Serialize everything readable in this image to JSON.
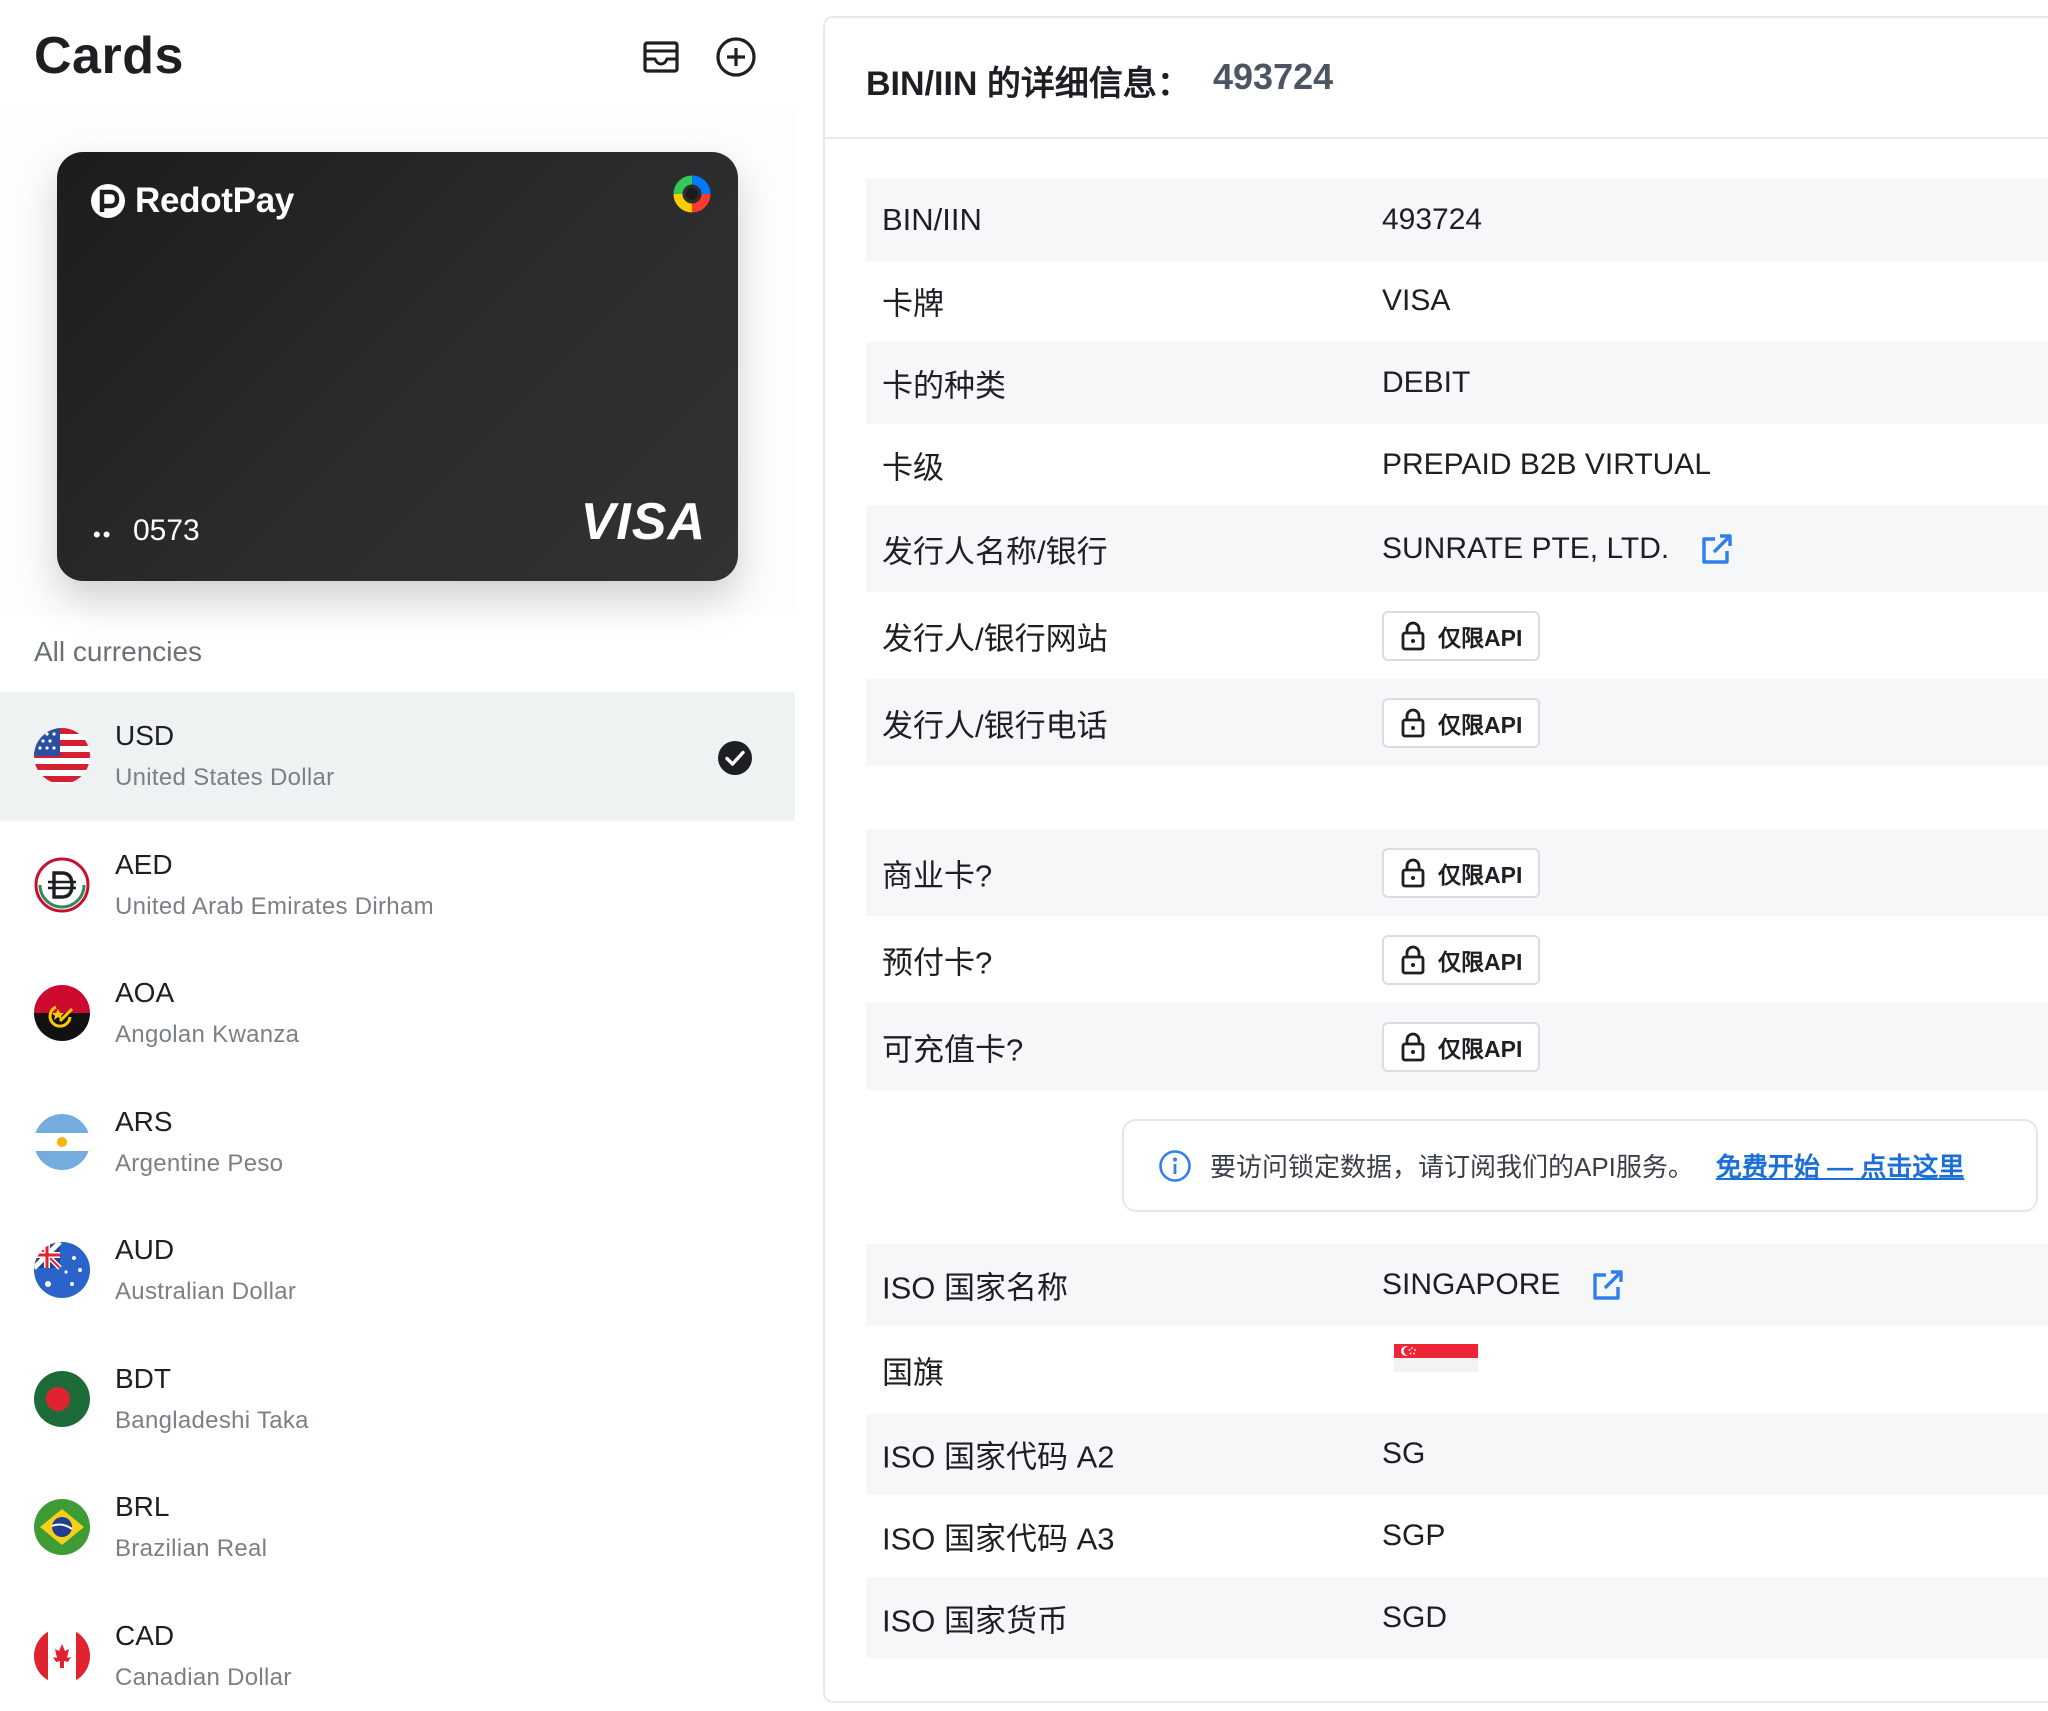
{
  "left": {
    "title": "Cards",
    "card": {
      "brand": "RedotPay",
      "masked_dots": "••",
      "last4": "0573",
      "network": "VISA"
    },
    "section_label": "All currencies",
    "currencies": [
      {
        "code": "USD",
        "name": "United States Dollar",
        "flag": "flag-us",
        "selected": true
      },
      {
        "code": "AED",
        "name": "United Arab Emirates Dirham",
        "flag": "flag-aed",
        "selected": false
      },
      {
        "code": "AOA",
        "name": "Angolan Kwanza",
        "flag": "flag-ao",
        "selected": false
      },
      {
        "code": "ARS",
        "name": "Argentine Peso",
        "flag": "flag-ar",
        "selected": false
      },
      {
        "code": "AUD",
        "name": "Australian Dollar",
        "flag": "flag-au",
        "selected": false
      },
      {
        "code": "BDT",
        "name": "Bangladeshi Taka",
        "flag": "flag-bd",
        "selected": false
      },
      {
        "code": "BRL",
        "name": "Brazilian Real",
        "flag": "flag-br",
        "selected": false
      },
      {
        "code": "CAD",
        "name": "Canadian Dollar",
        "flag": "flag-ca",
        "selected": false
      }
    ]
  },
  "right": {
    "header_label": "BIN/IIN 的详细信息：",
    "header_value": "493724",
    "rows": [
      {
        "label": "BIN/IIN",
        "value": "493724"
      },
      {
        "label": "卡牌",
        "value": "VISA"
      },
      {
        "label": "卡的种类",
        "value": "DEBIT"
      },
      {
        "label": "卡级",
        "value": "PREPAID B2B VIRTUAL"
      },
      {
        "label": "发行人名称/银行",
        "value": "SUNRATE PTE, LTD."
      },
      {
        "label": "发行人/银行网站",
        "value": ""
      },
      {
        "label": "发行人/银行电话",
        "value": ""
      },
      {
        "label": "商业卡?",
        "value": ""
      },
      {
        "label": "预付卡?",
        "value": ""
      },
      {
        "label": "可充值卡?",
        "value": ""
      }
    ],
    "api_badge": "仅限API",
    "notice_text": "要访问锁定数据，请订阅我们的API服务。",
    "notice_link": "免费开始 — 点击这里",
    "rows2": [
      {
        "label": "ISO 国家名称",
        "value": "SINGAPORE"
      },
      {
        "label": "国旗",
        "value": ""
      },
      {
        "label": "ISO 国家代码 A2",
        "value": "SG"
      },
      {
        "label": "ISO 国家代码 A3",
        "value": "SGP"
      },
      {
        "label": "ISO 国家货币",
        "value": "SGD"
      }
    ]
  },
  "colors": {
    "accent_link": "#1d6fd8",
    "selected_row": "#eef2f3",
    "card_bg": "#1c1c1e"
  }
}
